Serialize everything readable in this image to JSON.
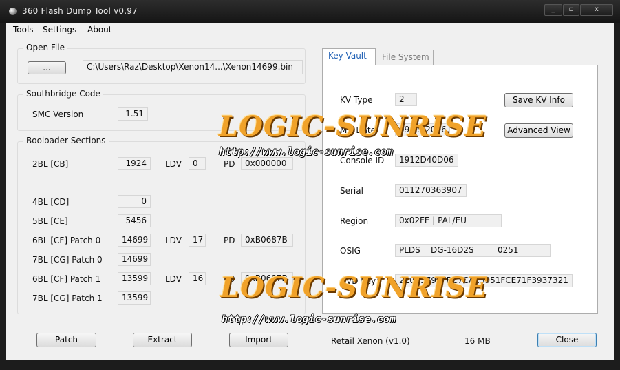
{
  "window": {
    "title": "360 Flash Dump Tool  v0.97",
    "controls": {
      "minimize": "_",
      "maximize": "▫",
      "close": "x"
    }
  },
  "menu": {
    "tools": "Tools",
    "settings": "Settings",
    "about": "About"
  },
  "open_file": {
    "label": "Open File",
    "browse_button": "...",
    "path": "C:\\Users\\Raz\\Desktop\\Xenon14...\\Xenon14699.bin"
  },
  "southbridge": {
    "label": "Southbridge Code",
    "smc_label": "SMC Version",
    "smc_value": "1.51"
  },
  "bootloader": {
    "label": "Booloader Sections",
    "ldv_label": "LDV",
    "pd_label": "PD",
    "rows": [
      {
        "name": "2BL [CB]",
        "value": "1924",
        "ldv": "0",
        "pd": "0x000000"
      },
      {
        "name": "4BL [CD]",
        "value": "0"
      },
      {
        "name": "5BL [CE]",
        "value": "5456"
      },
      {
        "name": "6BL [CF] Patch 0",
        "value": "14699",
        "ldv": "17",
        "pd": "0xB0687B"
      },
      {
        "name": "7BL [CG] Patch 0",
        "value": "14699"
      },
      {
        "name": "6BL [CF] Patch 1",
        "value": "13599",
        "ldv": "16",
        "pd": "0xB0687B"
      },
      {
        "name": "7BL [CG] Patch 1",
        "value": "13599"
      }
    ]
  },
  "tabs": {
    "key_vault": "Key Vault",
    "file_system": "File System"
  },
  "key_vault": {
    "kv_type_label": "KV Type",
    "kv_type": "2",
    "mfr_date_label": "Mfr Date",
    "mfr_date": "09 25 2006",
    "console_id_label": "Console ID",
    "console_id": "1912D40D06",
    "serial_label": "Serial",
    "serial": "011270363907",
    "region_label": "Region",
    "region": "0x02FE   |   PAL/EU",
    "osig_label": "OSIG",
    "osig": "PLDS    DG-16D2S         0251",
    "dvd_key_label": "DVD Key",
    "dvd_key": "220B3796FBC7CA13951FCE71F3937321",
    "save_button": "Save KV Info",
    "advanced_button": "Advanced View"
  },
  "footer": {
    "patch_button": "Patch",
    "extract_button": "Extract",
    "import_button": "Import",
    "console_type": "Retail Xenon (v1.0)",
    "size": "16 MB",
    "close_button": "Close"
  },
  "watermark": {
    "logo_text": "LOGIC-SUNRISE",
    "url": "http://www.logic-sunrise.com"
  }
}
